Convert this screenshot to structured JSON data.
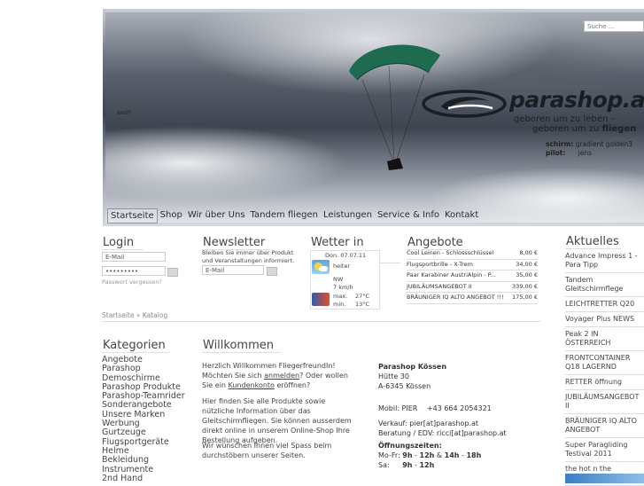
{
  "search": {
    "placeholder": "Suche ..."
  },
  "hero": {
    "logo": "parashop.at",
    "slogan_line1": "geboren um zu leben -",
    "slogan_line2_prefix": "geboren um zu",
    "slogan_line2_bold": "fliegen",
    "credit_schirm_label": "schirm:",
    "credit_schirm_value": "gradient golden3",
    "credit_pilot_label": "pilot:",
    "credit_pilot_value": "jens",
    "photographer": "andif"
  },
  "nav": {
    "items": [
      "Startseite",
      "Shop",
      "Wir über Uns",
      "Tandem fliegen",
      "Leistungen",
      "Service & Info",
      "Kontakt"
    ]
  },
  "login": {
    "title": "Login",
    "email_placeholder": "E-Mail",
    "password_value": "•••••••••",
    "forgot": "Passwort vergessen?"
  },
  "newsletter": {
    "title": "Newsletter",
    "text": "Bleiben Sie immer über Produkt und Veranstaltungen informiert.",
    "email_placeholder": "E-Mail"
  },
  "weather": {
    "title": "Wetter in Kössen",
    "date": "Don. 07.07.11",
    "condition": "heiter",
    "wind_dir": "NW",
    "wind_speed": "7 km/h",
    "max_label": "max.",
    "max_value": "27°C",
    "min_label": "min.",
    "min_value": "13°C"
  },
  "angebote": {
    "title": "Angebote",
    "rows": [
      {
        "name": "Cool Leinen - Schlossschlüssel",
        "price": "8,00 €"
      },
      {
        "name": "Flugsportbrille - X-Trem",
        "price": "34,00 €"
      },
      {
        "name": "Paar Karabiner AustriAlpin - P...",
        "price": "35,00 €"
      },
      {
        "name": "JUBILÄUMSANGEBOT II",
        "price": "339,00 €"
      },
      {
        "name": "BRÄUNIGER IQ ALTO ANGEBOT !!!",
        "price": "175,00 €"
      }
    ]
  },
  "aktuelles": {
    "title": "Aktuelles",
    "items": [
      "Advance Impress 1 - Para Tipp",
      "Tandem Gleitschirmflege",
      "LEICHTRETTER Q20",
      "Voyager Plus NEWS",
      "Peak 2 IN ÖSTERREICH",
      "FRONTCONTAINER Q18 LAGERND",
      "RETTER öffnung",
      "JUBILÄUMSANGEBOT II",
      "BRÄUNIGER IQ ALTO ANGEBOT",
      "Super Paragliding Testival 2011",
      "the hot n the freshness"
    ]
  },
  "breadcrumb": {
    "home": "Startseite",
    "sep": "»",
    "current": "Katalog"
  },
  "categories": {
    "title": "Kategorien",
    "items": [
      "Angebote",
      "Parashop Demoschirme",
      "Parashop Produkte",
      "Parashop-Teamrider",
      "Sonderangebote",
      "Unsere Marken",
      "Werbung",
      "Gurtzeuge",
      "Flugsportgeräte",
      "Helme",
      "Bekleidung",
      "Instrumente",
      "2nd Hand"
    ]
  },
  "welcome": {
    "title": "Willkommen",
    "p1_a": "Herzlich Willkommen FliegerfreundIn! Möchten Sie sich",
    "p1_link1": "anmelden",
    "p1_b": "? Oder wollen Sie ein",
    "p1_link2": "Kundenkonto",
    "p1_c": "eröffnen?",
    "p2": "Hier finden Sie alle Produkte sowie nützliche Information über das Gleitschirmfliegen. Sie können ausserdem direkt online in unserem Online-Shop Ihre Bestellung aufgeben.",
    "p3": "Wir wünschen Ihnen viel Spass beim durchstöbern unserer Seiten."
  },
  "contact": {
    "name": "Parashop Kössen",
    "street": "Hütte 30",
    "city": "A-6345 Kössen",
    "mobil_label": "Mobil: PIER",
    "mobil_value": "+43 664 2054321",
    "verkauf": "Verkauf:  pier[at]parashop.at",
    "beratung": "Beratung / EDV:  ricci[at]parashop.at",
    "hours_title": "Öffnungszeiten:",
    "hours_mofr_label": "Mo-Fr:",
    "hours_mofr_1": "9h",
    "hours_mofr_2": "12h",
    "hours_mofr_3": "14h",
    "hours_mofr_4": "18h",
    "hours_sa_label": "Sa:",
    "hours_sa_1": "9h",
    "hours_sa_2": "12h"
  },
  "colors": {
    "accent": "#555555",
    "link": "#333333"
  }
}
